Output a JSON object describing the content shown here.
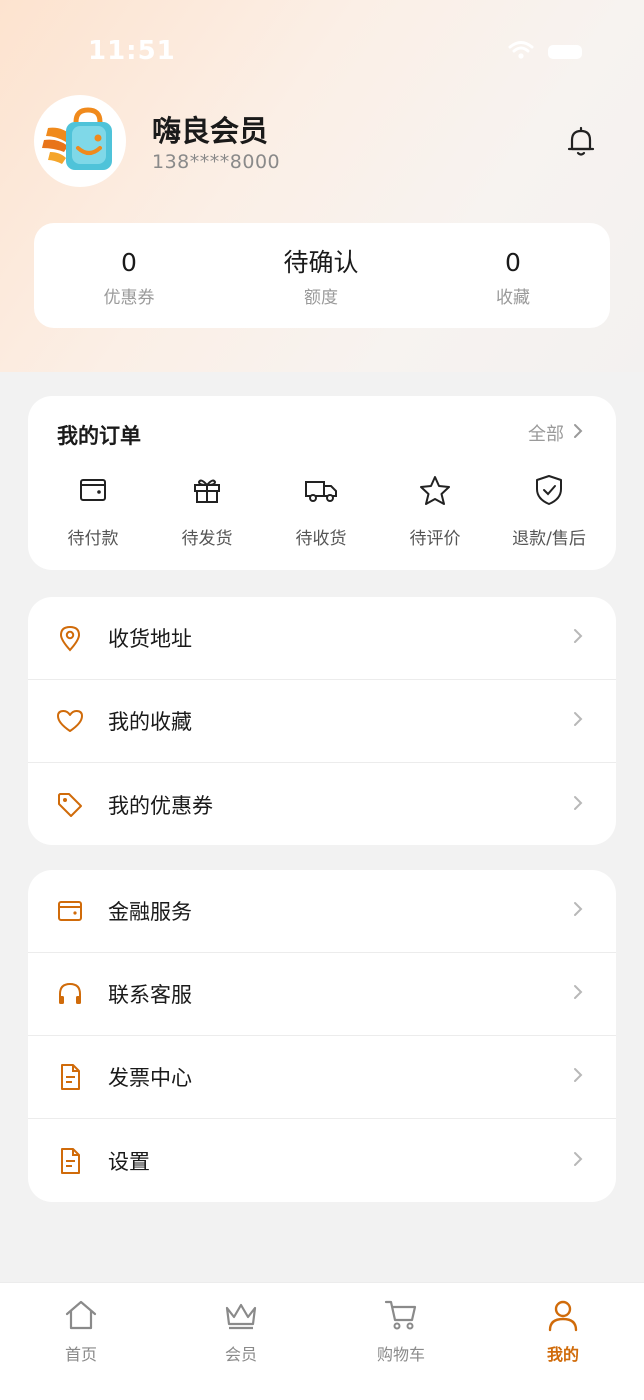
{
  "status_bar": {
    "time": "11:51"
  },
  "profile": {
    "name": "嗨良会员",
    "phone": "138****8000"
  },
  "stats": [
    {
      "value": "0",
      "label": "优惠券"
    },
    {
      "value": "待确认",
      "label": "额度"
    },
    {
      "value": "0",
      "label": "收藏"
    }
  ],
  "orders": {
    "title": "我的订单",
    "all_label": "全部",
    "items": [
      {
        "label": "待付款",
        "icon": "wallet-icon"
      },
      {
        "label": "待发货",
        "icon": "gift-icon"
      },
      {
        "label": "待收货",
        "icon": "truck-icon"
      },
      {
        "label": "待评价",
        "icon": "star-icon"
      },
      {
        "label": "退款/售后",
        "icon": "shield-check-icon"
      }
    ]
  },
  "menu_group_1": [
    {
      "label": "收货地址",
      "icon": "location-pin-icon"
    },
    {
      "label": "我的收藏",
      "icon": "heart-icon"
    },
    {
      "label": "我的优惠券",
      "icon": "tag-icon"
    }
  ],
  "menu_group_2": [
    {
      "label": "金融服务",
      "icon": "wallet-icon"
    },
    {
      "label": "联系客服",
      "icon": "headphones-icon"
    },
    {
      "label": "发票中心",
      "icon": "document-icon"
    },
    {
      "label": "设置",
      "icon": "document-icon"
    }
  ],
  "tabbar": [
    {
      "label": "首页",
      "icon": "home-icon",
      "active": false
    },
    {
      "label": "会员",
      "icon": "crown-icon",
      "active": false
    },
    {
      "label": "购物车",
      "icon": "cart-icon",
      "active": false
    },
    {
      "label": "我的",
      "icon": "user-icon",
      "active": true
    }
  ],
  "colors": {
    "accent": "#d06b0a",
    "background": "#f2f2f2",
    "hero_start": "#fde3cf"
  }
}
